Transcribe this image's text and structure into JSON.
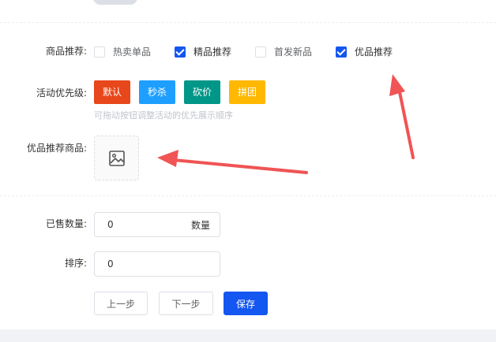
{
  "recommend": {
    "label": "商品推荐:",
    "options": [
      {
        "label": "热卖单品",
        "checked": false
      },
      {
        "label": "精品推荐",
        "checked": true
      },
      {
        "label": "首发新品",
        "checked": false
      },
      {
        "label": "优品推荐",
        "checked": true
      }
    ]
  },
  "priority": {
    "label": "活动优先级:",
    "tags": [
      {
        "label": "默认",
        "color": "#e8471b"
      },
      {
        "label": "秒杀",
        "color": "#1e9fff"
      },
      {
        "label": "砍价",
        "color": "#009688"
      },
      {
        "label": "拼团",
        "color": "#ffb800"
      }
    ],
    "hint": "可拖动按钮调整活动的优先展示顺序"
  },
  "premium_goods": {
    "label": "优品推荐商品:",
    "upload_icon": "image-placeholder-icon"
  },
  "sold": {
    "label": "已售数量:",
    "value": "0",
    "suffix": "数量"
  },
  "sort": {
    "label": "排序:",
    "value": "0"
  },
  "actions": {
    "prev_label": "上一步",
    "next_label": "下一步",
    "save_label": "保存"
  },
  "colors": {
    "primary": "#1456f0",
    "annotation_arrow": "#f05454"
  }
}
